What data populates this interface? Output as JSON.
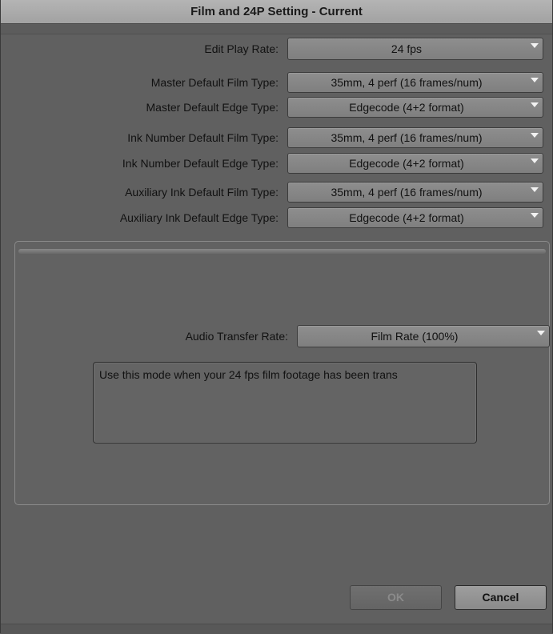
{
  "window": {
    "title": "Film and 24P Setting - Current"
  },
  "settings": [
    {
      "label": "Edit Play Rate:",
      "value": "24 fps"
    },
    {
      "label": "Master Default Film Type:",
      "value": "35mm, 4 perf (16 frames/num)"
    },
    {
      "label": "Master Default Edge Type:",
      "value": "Edgecode (4+2 format)"
    },
    {
      "label": "Ink Number Default Film Type:",
      "value": "35mm, 4 perf (16 frames/num)"
    },
    {
      "label": "Ink Number Default Edge Type:",
      "value": "Edgecode (4+2 format)"
    },
    {
      "label": "Auxiliary Ink Default Film Type:",
      "value": "35mm, 4 perf (16 frames/num)"
    },
    {
      "label": "Auxiliary Ink Default Edge Type:",
      "value": "Edgecode (4+2 format)"
    }
  ],
  "audio": {
    "label": "Audio Transfer Rate:",
    "value": "Film Rate (100%)",
    "description": "Use this mode when your 24 fps film footage has been trans"
  },
  "buttons": {
    "ok": "OK",
    "cancel": "Cancel"
  },
  "icons": {
    "dropdown_arrow": "chevron-down-icon"
  },
  "colors": {
    "background": "#606060",
    "titlebar": "#a8a8a8",
    "dropdown": "#888888"
  }
}
